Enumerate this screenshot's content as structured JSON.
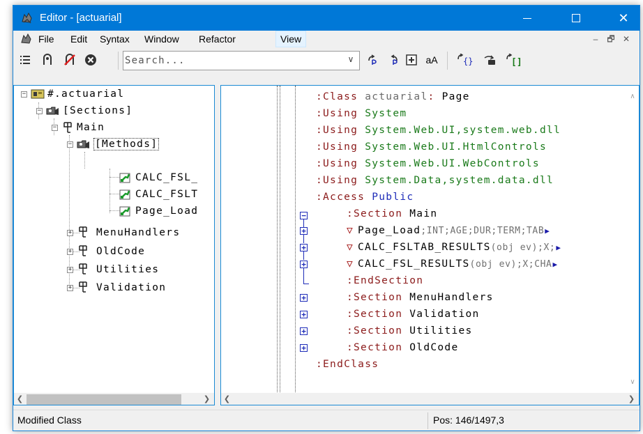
{
  "window": {
    "title": "Editor - [actuarial]",
    "accent_color": "#0078d7",
    "controls": {
      "minimize": "minimize-icon",
      "maximize": "maximize-icon",
      "close": "✕"
    }
  },
  "menu": {
    "items": [
      "File",
      "Edit",
      "Syntax",
      "Window",
      "Refactor",
      "View"
    ],
    "active": "View",
    "mdi_controls": [
      "–",
      "🗗",
      "✕"
    ]
  },
  "toolbar": {
    "left_icons": [
      "outline-icon",
      "bookmark-icon",
      "clear-bookmark-icon",
      "cancel-icon"
    ],
    "search_placeholder": "Search...",
    "right_icons": [
      "goto-next-icon",
      "goto-prev-icon",
      "expand-all-icon",
      "case-icon",
      "braces-icon",
      "navigate-icon",
      "brackets-icon"
    ],
    "case_label": "aA"
  },
  "tree": {
    "nodes": [
      {
        "label": "#.actuarial",
        "expander": "−",
        "icon": "class-icon"
      },
      {
        "label": "[Sections]",
        "expander": "−",
        "icon": "folder-icon"
      },
      {
        "label": "Main",
        "expander": "−",
        "icon": "section-icon"
      },
      {
        "label": "[Methods]",
        "expander": "−",
        "icon": "folder-icon"
      },
      {
        "label": "CALC_FSL_",
        "expander": "",
        "icon": "method-icon"
      },
      {
        "label": "CALC_FSLT",
        "expander": "",
        "icon": "method-icon"
      },
      {
        "label": "Page_Load",
        "expander": "",
        "icon": "method-icon"
      },
      {
        "label": "MenuHandlers",
        "expander": "+",
        "icon": "section-icon"
      },
      {
        "label": "OldCode",
        "expander": "+",
        "icon": "section-icon"
      },
      {
        "label": "Utilities",
        "expander": "+",
        "icon": "section-icon"
      },
      {
        "label": "Validation",
        "expander": "+",
        "icon": "section-icon"
      }
    ]
  },
  "code": {
    "lines": [
      {
        "parts": [
          [
            ":Class ",
            "kw"
          ],
          [
            "actuarial",
            "name"
          ],
          [
            ": ",
            "kw"
          ],
          [
            "Page",
            "black"
          ]
        ]
      },
      {
        "parts": [
          [
            ":Using ",
            "kw"
          ],
          [
            "System",
            "type"
          ]
        ]
      },
      {
        "parts": [
          [
            ":Using ",
            "kw"
          ],
          [
            "System.Web.UI,system.web.dll",
            "type"
          ]
        ]
      },
      {
        "parts": [
          [
            ":Using ",
            "kw"
          ],
          [
            "System.Web.UI.HtmlControls",
            "type"
          ]
        ]
      },
      {
        "parts": [
          [
            ":Using ",
            "kw"
          ],
          [
            "System.Web.UI.WebControls",
            "type"
          ]
        ]
      },
      {
        "parts": [
          [
            ":Using ",
            "kw"
          ],
          [
            "System.Data,system.data.dll",
            "type"
          ]
        ]
      },
      {
        "parts": [
          [
            ":Access ",
            "kw"
          ],
          [
            "Public",
            "blue"
          ]
        ]
      },
      {
        "parts": [
          [
            ":Section ",
            "kw"
          ],
          [
            "Main",
            "black"
          ]
        ]
      },
      {
        "parts": [
          [
            "▽",
            "tri"
          ],
          [
            "Page_Load",
            "black"
          ],
          [
            ";INT;AGE;DUR;TERM;TAB",
            "grey"
          ]
        ],
        "more": true
      },
      {
        "parts": [
          [
            "▽",
            "tri"
          ],
          [
            "CALC_FSLTAB_RESULTS",
            "black"
          ],
          [
            "(obj ev);X;",
            "grey"
          ]
        ],
        "more": true
      },
      {
        "parts": [
          [
            "▽",
            "tri"
          ],
          [
            "CALC_FSL_RESULTS",
            "black"
          ],
          [
            "(obj ev);X;CHA",
            "grey"
          ]
        ],
        "more": true
      },
      {
        "parts": [
          [
            ":EndSection",
            "kw"
          ]
        ]
      },
      {
        "parts": [
          [
            ":Section ",
            "kw"
          ],
          [
            "MenuHandlers",
            "black"
          ]
        ]
      },
      {
        "parts": [
          [
            ":Section ",
            "kw"
          ],
          [
            "Validation",
            "black"
          ]
        ]
      },
      {
        "parts": [
          [
            ":Section ",
            "kw"
          ],
          [
            "Utilities",
            "black"
          ]
        ]
      },
      {
        "parts": [
          [
            ":Section ",
            "kw"
          ],
          [
            "OldCode",
            "black"
          ]
        ]
      },
      {
        "parts": [
          [
            ":EndClass",
            "kw"
          ]
        ]
      }
    ],
    "more_marker": "▶"
  },
  "status": {
    "message": "Modified Class",
    "position": "Pos: 146/1497,3"
  }
}
